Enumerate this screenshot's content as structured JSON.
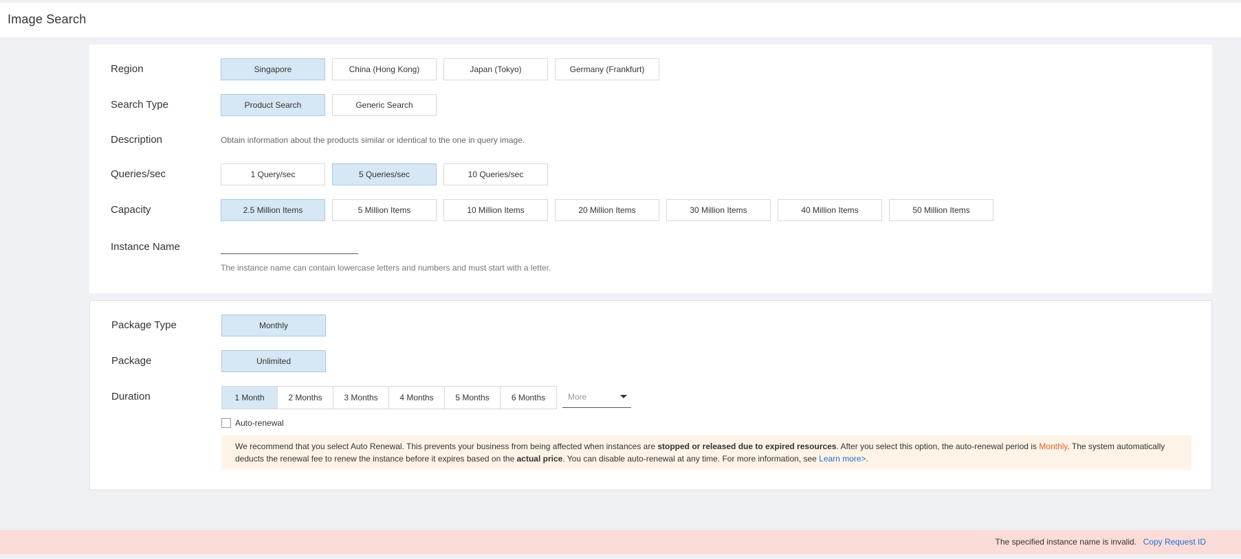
{
  "page": {
    "title": "Image Search"
  },
  "region": {
    "label": "Region",
    "options": [
      "Singapore",
      "China (Hong Kong)",
      "Japan (Tokyo)",
      "Germany (Frankfurt)"
    ],
    "selected": "Singapore"
  },
  "search_type": {
    "label": "Search Type",
    "options": [
      "Product Search",
      "Generic Search"
    ],
    "selected": "Product Search"
  },
  "description": {
    "label": "Description",
    "text": "Obtain information about the products similar or identical to the one in query image."
  },
  "queries": {
    "label": "Queries/sec",
    "options": [
      "1 Query/sec",
      "5 Queries/sec",
      "10 Queries/sec"
    ],
    "selected": "5 Queries/sec"
  },
  "capacity": {
    "label": "Capacity",
    "options": [
      "2.5 Million Items",
      "5 Million Items",
      "10 Million Items",
      "20 Million Items",
      "30 Million Items",
      "40 Million Items",
      "50 Million Items"
    ],
    "selected": "2.5 Million Items"
  },
  "instance_name": {
    "label": "Instance Name",
    "value": "",
    "help": "The instance name can contain lowercase letters and numbers and must start with a letter."
  },
  "package_type": {
    "label": "Package Type",
    "options": [
      "Monthly"
    ],
    "selected": "Monthly"
  },
  "package": {
    "label": "Package",
    "options": [
      "Unlimited"
    ],
    "selected": "Unlimited"
  },
  "duration": {
    "label": "Duration",
    "options": [
      "1 Month",
      "2 Months",
      "3 Months",
      "4 Months",
      "5 Months",
      "6 Months"
    ],
    "selected": "1 Month",
    "more_label": "More"
  },
  "auto_renewal": {
    "label": "Auto-renewal",
    "checked": false
  },
  "notice": {
    "part1": "We recommend that you select Auto Renewal. This prevents your business from being affected when instances are ",
    "bold1": "stopped or released due to expired resources",
    "part2": ". After you select this option, the auto-renewal period is ",
    "period": "Monthly",
    "part3": ". The system automatically deducts the renewal fee to renew the instance before it expires based on the ",
    "bold2": "actual price",
    "part4": ". You can disable auto-renewal at any time. For more information, see ",
    "link": "Learn more>",
    "part5": "."
  },
  "error": {
    "message": "The specified instance name is invalid.",
    "copy_link": "Copy Request ID"
  },
  "colors": {
    "selected_bg": "#d6e7f5",
    "notice_bg": "#fef3e7",
    "error_bg": "#fcdcd9",
    "link": "#1f6fd1",
    "accent": "#e4612f"
  }
}
